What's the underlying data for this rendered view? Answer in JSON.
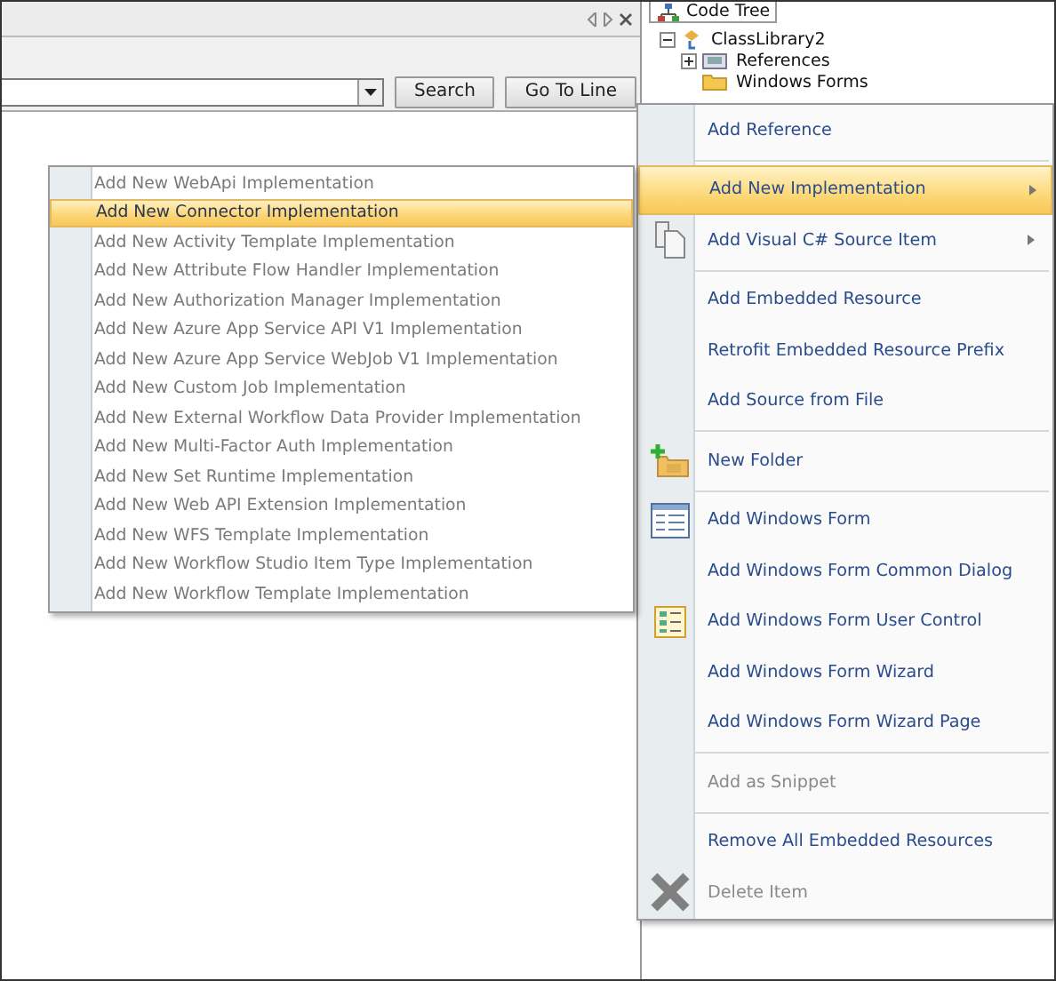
{
  "search_bar": {
    "buttons": [
      "Search",
      "Go To Line"
    ]
  },
  "code_tree": {
    "tab": "Code Tree",
    "tree": [
      {
        "label": "ClassLibrary2",
        "kind": "project",
        "expanded": true,
        "selected": false,
        "children": [
          {
            "label": "References",
            "kind": "references",
            "expanded": false,
            "selected": false
          },
          {
            "label": "Windows Forms",
            "kind": "folder",
            "selected": false
          }
        ]
      }
    ]
  },
  "context_menu": {
    "items": [
      {
        "label": "Add Reference",
        "disabled": false,
        "selected": false,
        "submenu": false,
        "separator_after": true
      },
      {
        "label": "Add New Implementation",
        "disabled": false,
        "selected": true,
        "submenu": true,
        "separator_after": false
      },
      {
        "label": "Add Visual C# Source Item",
        "disabled": false,
        "selected": false,
        "submenu": true,
        "kind": "document",
        "separator_after": true
      },
      {
        "label": "Add Embedded Resource",
        "disabled": false,
        "selected": false,
        "submenu": false,
        "separator_after": false
      },
      {
        "label": "Retrofit Embedded Resource Prefix",
        "disabled": false,
        "selected": false,
        "submenu": false,
        "separator_after": false
      },
      {
        "label": "Add Source from File",
        "disabled": false,
        "selected": false,
        "submenu": false,
        "separator_after": true
      },
      {
        "label": "New Folder",
        "disabled": false,
        "selected": false,
        "submenu": false,
        "kind": "folder",
        "separator_after": true
      },
      {
        "label": "Add Windows Form",
        "disabled": false,
        "selected": false,
        "submenu": false,
        "kind": "form",
        "separator_after": false
      },
      {
        "label": "Add Windows Form Common Dialog",
        "disabled": false,
        "selected": false,
        "submenu": false,
        "separator_after": false
      },
      {
        "label": "Add Windows Form User Control",
        "disabled": false,
        "selected": false,
        "submenu": false,
        "kind": "control",
        "separator_after": false
      },
      {
        "label": "Add Windows Form Wizard",
        "disabled": false,
        "selected": false,
        "submenu": false,
        "separator_after": false
      },
      {
        "label": "Add Windows Form Wizard Page",
        "disabled": false,
        "selected": false,
        "submenu": false,
        "separator_after": true
      },
      {
        "label": "Add as Snippet",
        "disabled": true,
        "selected": false,
        "submenu": false,
        "separator_after": true
      },
      {
        "label": "Remove All Embedded Resources",
        "disabled": false,
        "selected": false,
        "submenu": false,
        "separator_after": false
      },
      {
        "label": "Delete Item",
        "disabled": true,
        "selected": false,
        "submenu": false,
        "kind": "delete",
        "separator_after": false
      }
    ]
  },
  "submenu": {
    "items": [
      {
        "label": "Add New WebApi Implementation",
        "selected": false
      },
      {
        "label": "Add New Connector Implementation",
        "selected": true
      },
      {
        "label": "Add New Activity Template Implementation",
        "selected": false
      },
      {
        "label": "Add New Attribute Flow Handler Implementation",
        "selected": false
      },
      {
        "label": "Add New Authorization Manager Implementation",
        "selected": false
      },
      {
        "label": "Add New Azure App Service API V1 Implementation",
        "selected": false
      },
      {
        "label": "Add New Azure App Service WebJob V1 Implementation",
        "selected": false
      },
      {
        "label": "Add New Custom Job Implementation",
        "selected": false
      },
      {
        "label": "Add New External Workflow Data Provider Implementation",
        "selected": false
      },
      {
        "label": "Add New Multi-Factor Auth Implementation",
        "selected": false
      },
      {
        "label": "Add New Set Runtime Implementation",
        "selected": false
      },
      {
        "label": "Add New Web API Extension Implementation",
        "selected": false
      },
      {
        "label": "Add New WFS Template Implementation",
        "selected": false
      },
      {
        "label": "Add New Workflow Studio Item Type Implementation",
        "selected": false
      },
      {
        "label": "Add New Workflow Template Implementation",
        "selected": false
      }
    ]
  }
}
